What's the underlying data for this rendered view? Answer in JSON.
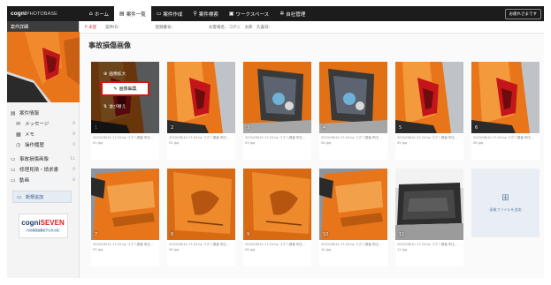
{
  "header": {
    "logo": "cogni",
    "logo_sub": "PHOTOBASE",
    "nav": [
      {
        "label": "ホーム",
        "icon": "home-icon"
      },
      {
        "label": "案件一覧",
        "icon": "list-icon"
      },
      {
        "label": "案件作成",
        "icon": "create-icon"
      },
      {
        "label": "案件検索",
        "icon": "search-icon"
      },
      {
        "label": "ワークスペース",
        "icon": "workspace-icon"
      },
      {
        "label": "自社管理",
        "icon": "settings-icon"
      }
    ],
    "active_nav": 1,
    "user_button": "お疲れさまです"
  },
  "sidebar": {
    "header": "案件詳細",
    "items": [
      {
        "label": "案件情報",
        "icon": "info-icon",
        "count": ""
      },
      {
        "label": "メッセージ",
        "icon": "message-icon",
        "count": "0"
      },
      {
        "label": "メモ",
        "icon": "memo-icon",
        "count": "0"
      },
      {
        "label": "操作履歴",
        "icon": "history-icon",
        "count": "0"
      },
      {
        "label": "事故損傷画像",
        "icon": "folder-icon",
        "count": "11"
      },
      {
        "label": "修理見積・請求書",
        "icon": "folder-icon",
        "count": "0"
      },
      {
        "label": "動画",
        "icon": "folder-icon",
        "count": "0"
      }
    ],
    "add_button": "新規追加",
    "brand_logo": "cogniSEVEN",
    "brand_tag": "AIが損害画像をデジタル化"
  },
  "info_bar": {
    "flag": "P 未登",
    "fields": [
      "案件ID：",
      "登録番号：",
      "お客様名：コグニ　太郎　久喜日："
    ]
  },
  "page_title": "事故損傷画像",
  "photos": [
    {
      "num": "1",
      "meta1": "2022/08/10 17:24 by コグニ損害 明王...",
      "meta2": "01.jpg",
      "scene": "taillight"
    },
    {
      "num": "2",
      "meta1": "2022/08/10 17:24 by コグニ損害 明王...",
      "meta2": "02.jpg",
      "scene": "taillight"
    },
    {
      "num": "3",
      "meta1": "2022/08/10 17:24 by コグニ損害 明王...",
      "meta2": "03.jpg",
      "scene": "hatch"
    },
    {
      "num": "4",
      "meta1": "2022/08/10 17:24 by コグニ損害 明王...",
      "meta2": "04.jpg",
      "scene": "hatch"
    },
    {
      "num": "5",
      "meta1": "2022/08/10 17:24 by コグニ損害 明王...",
      "meta2": "05.jpg",
      "scene": "taillight"
    },
    {
      "num": "6",
      "meta1": "2022/08/10 17:24 by コグニ損害 明王...",
      "meta2": "06.jpg",
      "scene": "taillight"
    },
    {
      "num": "7",
      "meta1": "2022/08/10 17:24 by コグニ損害 明王...",
      "meta2": "07.jpg",
      "scene": "side"
    },
    {
      "num": "8",
      "meta1": "2022/08/10 17:24 by コグニ損害 明王...",
      "meta2": "08.jpg",
      "scene": "panel"
    },
    {
      "num": "9",
      "meta1": "2022/08/10 17:24 by コグニ損害 明王...",
      "meta2": "09.jpg",
      "scene": "panel"
    },
    {
      "num": "10",
      "meta1": "2022/08/10 17:24 by コグニ損害 明王...",
      "meta2": "10.jpg",
      "scene": "side"
    },
    {
      "num": "11",
      "meta1": "2022/08/10 17:24 by コグニ損害 明王...",
      "meta2": "11.jpg",
      "scene": "trunk"
    }
  ],
  "overlay": {
    "zoom": "画像拡大",
    "edit": "画像編集",
    "reorder": "並び替え"
  },
  "add_tile": {
    "label": "画像ファイルを追加",
    "icon": "add-image-icon"
  },
  "colors": {
    "header_bg": "#1c1c1c",
    "car_orange": "#e8751a",
    "highlight_red": "#e01010",
    "accent_blue": "#2b5c8f"
  }
}
